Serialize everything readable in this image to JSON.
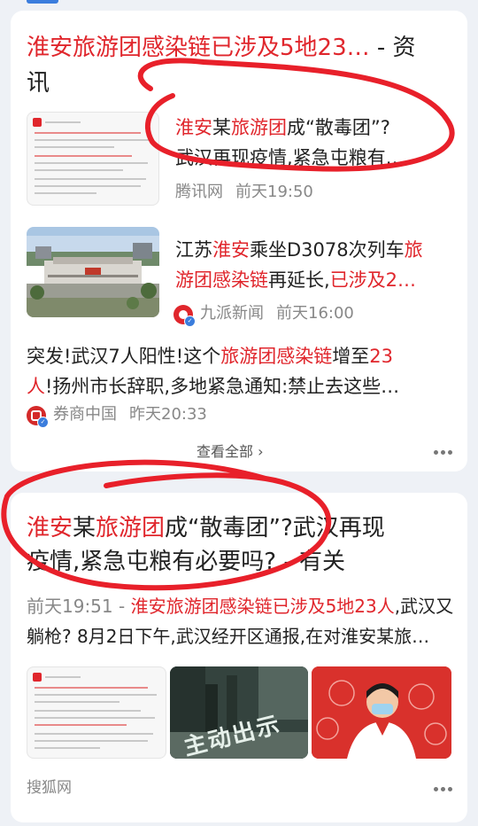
{
  "colors": {
    "accent_red": "#e0262c",
    "background": "#eef1f6",
    "verify_blue": "#3b7ddd",
    "annotation_red": "#e8202a"
  },
  "card1": {
    "title_red": "淮安旅游团感染链已涉及5地23…",
    "title_rest_1": " - 资",
    "title_rest_2": "讯",
    "items": [
      {
        "line1": [
          {
            "t": "淮安",
            "hl": true
          },
          {
            "t": "某",
            "hl": false
          },
          {
            "t": "旅游团",
            "hl": true
          },
          {
            "t": "成“散毒团”?",
            "hl": false
          }
        ],
        "line2": "武汉再现疫情,紧急屯粮有…",
        "source": "腾讯网",
        "time": "前天19:50",
        "thumb_icon": "document-icon"
      },
      {
        "line1": [
          {
            "t": "江苏",
            "hl": false
          },
          {
            "t": "淮安",
            "hl": true
          },
          {
            "t": "乘坐D3078次列车",
            "hl": false
          },
          {
            "t": "旅",
            "hl": true
          }
        ],
        "line2": [
          {
            "t": "游团感染链",
            "hl": true
          },
          {
            "t": "再延长,",
            "hl": false
          },
          {
            "t": "已涉及2…",
            "hl": true
          }
        ],
        "source": "九派新闻",
        "time": "前天16:00",
        "thumb_icon": "train-station-photo"
      },
      {
        "line1": [
          {
            "t": "突发!武汉7人阳性!这个",
            "hl": false
          },
          {
            "t": "旅游团感染链",
            "hl": true
          },
          {
            "t": "增至",
            "hl": false
          },
          {
            "t": "23",
            "hl": true
          }
        ],
        "line2": [
          {
            "t": "人",
            "hl": true
          },
          {
            "t": "!扬州市长辞职,多地紧急通知:禁止去这些…",
            "hl": false
          }
        ],
        "source": "券商中国",
        "time": "昨天20:33"
      }
    ],
    "view_all": "查看全部",
    "view_all_arrow": "›"
  },
  "card2": {
    "title_line1": [
      {
        "t": "淮安",
        "hl": true
      },
      {
        "t": "某",
        "hl": false
      },
      {
        "t": "旅游团",
        "hl": true
      },
      {
        "t": "成“散毒团”?武汉再现",
        "hl": false
      }
    ],
    "title_line2": "疫情,紧急屯粮有必要吗? - 有关",
    "snippet_line1": [
      {
        "t": "前天19:51 - ",
        "hl": false,
        "grey": true
      },
      {
        "t": "淮安旅游团感染链已涉及5地23人",
        "hl": true
      },
      {
        "t": ",武汉又",
        "hl": false
      }
    ],
    "snippet_line2": "躺枪? 8月2日下午,武汉经开区通报,在对淮安某旅…",
    "images": [
      "document-image",
      "street-photo-image",
      "illustration-image"
    ],
    "image2_caption": "主动出示",
    "source": "搜狐网"
  }
}
